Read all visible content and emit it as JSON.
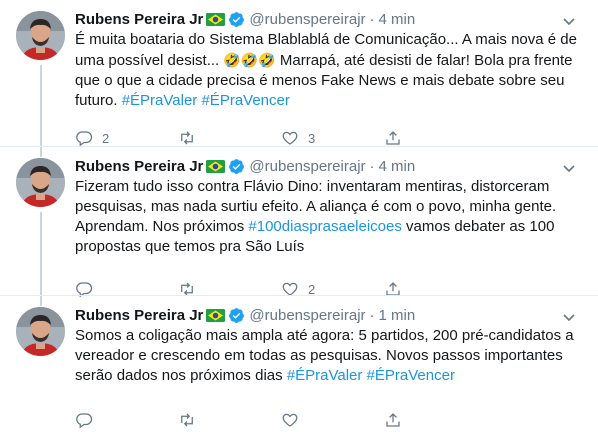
{
  "tweets": [
    {
      "name": "Rubens Pereira Jr",
      "handle": "@rubenspereirajr",
      "separator": "·",
      "time": "4 min",
      "text_parts": [
        {
          "type": "text",
          "value": "É muita boataria do Sistema Blablablá de Comunicação... A mais nova é de uma possível desist... "
        },
        {
          "type": "emoji",
          "value": "🤣🤣🤣"
        },
        {
          "type": "text",
          "value": " Marrapá, até desisti de falar! Bola pra frente que o que a cidade precisa é menos Fake News e mais debate sobre seu futuro. "
        },
        {
          "type": "hashtag",
          "value": "#ÉPraValer"
        },
        {
          "type": "text",
          "value": " "
        },
        {
          "type": "hashtag",
          "value": "#ÉPraVencer"
        }
      ],
      "replies": "2",
      "retweets": "",
      "likes": "3"
    },
    {
      "name": "Rubens Pereira Jr",
      "handle": "@rubenspereirajr",
      "separator": "·",
      "time": "4 min",
      "text_parts": [
        {
          "type": "text",
          "value": "Fizeram tudo isso contra Flávio Dino: inventaram mentiras, distorceram pesquisas, mas nada surtiu efeito. A aliança é com o povo, minha gente. Aprendam. Nos próximos "
        },
        {
          "type": "hashtag",
          "value": "#100diasprasaeleicoes"
        },
        {
          "type": "text",
          "value": " vamos debater as 100 propostas que temos pra São Luís"
        }
      ],
      "replies": "",
      "retweets": "",
      "likes": "2"
    },
    {
      "name": "Rubens Pereira Jr",
      "handle": "@rubenspereirajr",
      "separator": "·",
      "time": "1 min",
      "text_parts": [
        {
          "type": "text",
          "value": "Somos a coligação mais ampla até agora: 5 partidos, 200 pré-candidatos a vereador e crescendo em todas as pesquisas. Novos passos importantes serão dados nos próximos dias "
        },
        {
          "type": "hashtag",
          "value": "#ÉPraValer"
        },
        {
          "type": "text",
          "value": " "
        },
        {
          "type": "hashtag",
          "value": "#ÉPraVencer"
        }
      ],
      "replies": "",
      "retweets": "",
      "likes": ""
    }
  ],
  "icons": {
    "verified": "verified-badge-icon",
    "flag": "brazil-flag-icon",
    "caret": "chevron-down-icon",
    "reply": "reply-icon",
    "retweet": "retweet-icon",
    "like": "heart-icon",
    "share": "share-icon"
  },
  "colors": {
    "link": "#1b95e0",
    "muted": "#657786",
    "divider": "#e6ecf0",
    "thread_line": "#ccd6dd",
    "verified": "#1da1f2"
  }
}
